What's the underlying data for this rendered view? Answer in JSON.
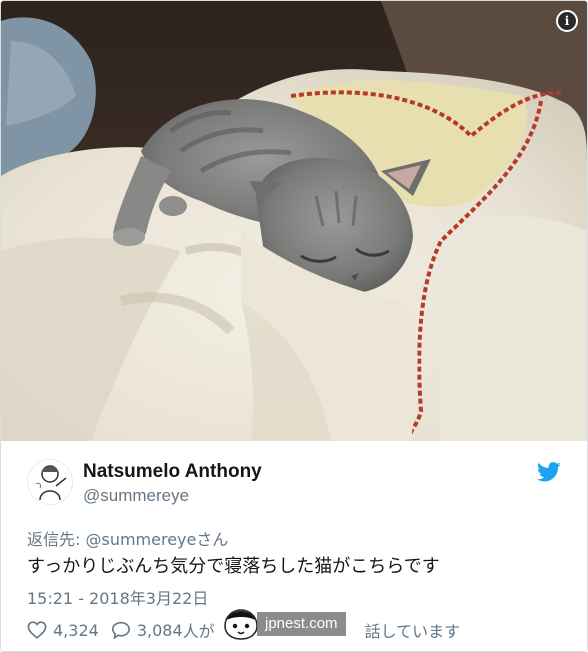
{
  "photo": {
    "info_label": "i"
  },
  "author": {
    "display_name": "Natsumelo Anthony",
    "handle": "@summereye"
  },
  "tweet": {
    "reply_prefix": "返信先: ",
    "reply_to": "@summereye",
    "reply_suffix": "さん",
    "text": "すっかりじぶんち気分で寝落ちした猫がこちらです",
    "timestamp": "15:21 - 2018年3月22日"
  },
  "actions": {
    "likes": "4,324",
    "replies": "3,084",
    "talk_text_start": "人が",
    "talk_text_end": "話しています"
  },
  "watermark": {
    "text": "jpnest.com"
  },
  "colors": {
    "brand_blue": "#1da1f2",
    "text_primary": "#14171a",
    "text_secondary": "#657786"
  }
}
